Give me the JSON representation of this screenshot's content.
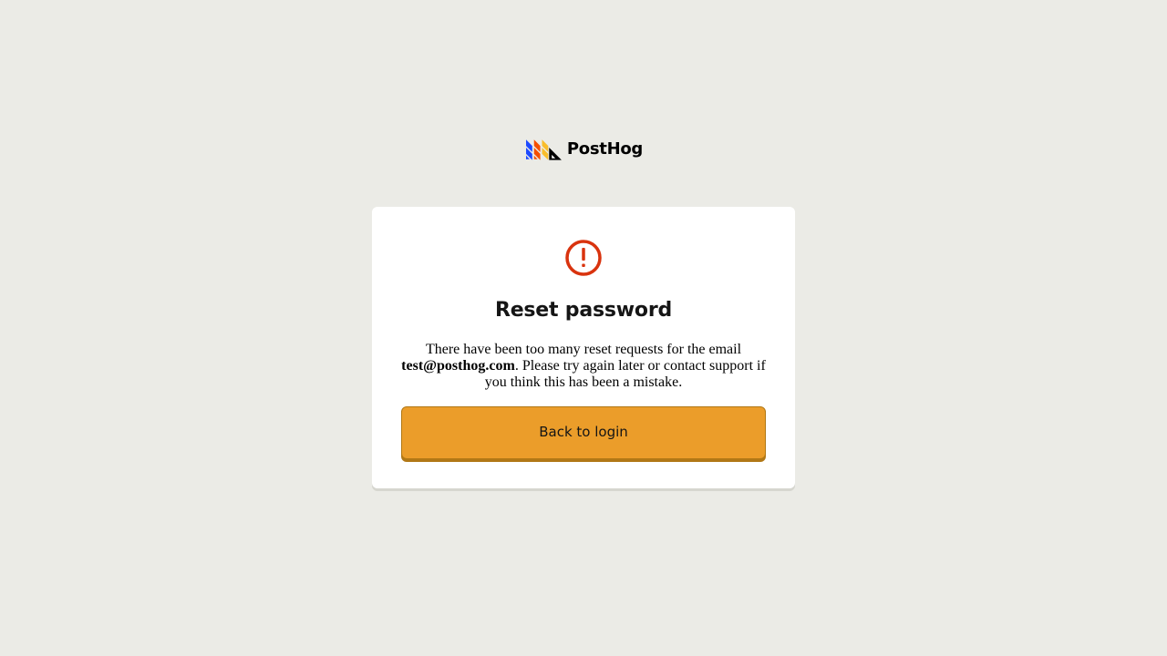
{
  "brand": {
    "name": "PostHog",
    "colors": {
      "blue": "#1d4aff",
      "orange": "#f54e00",
      "yellow": "#f9bd2b",
      "black": "#000000"
    },
    "logo_icon": "posthog-logo-icon"
  },
  "card": {
    "icon": "exclamation-circle-icon",
    "icon_color": "#d9330e",
    "title": "Reset password",
    "message_before": "There have been too many reset requests for the email ",
    "email": "test@posthog.com",
    "message_after": ". Please try again later or contact support if you think this has been a mistake.",
    "back_button_label": "Back to login",
    "button_color": "#eb9d2a"
  }
}
